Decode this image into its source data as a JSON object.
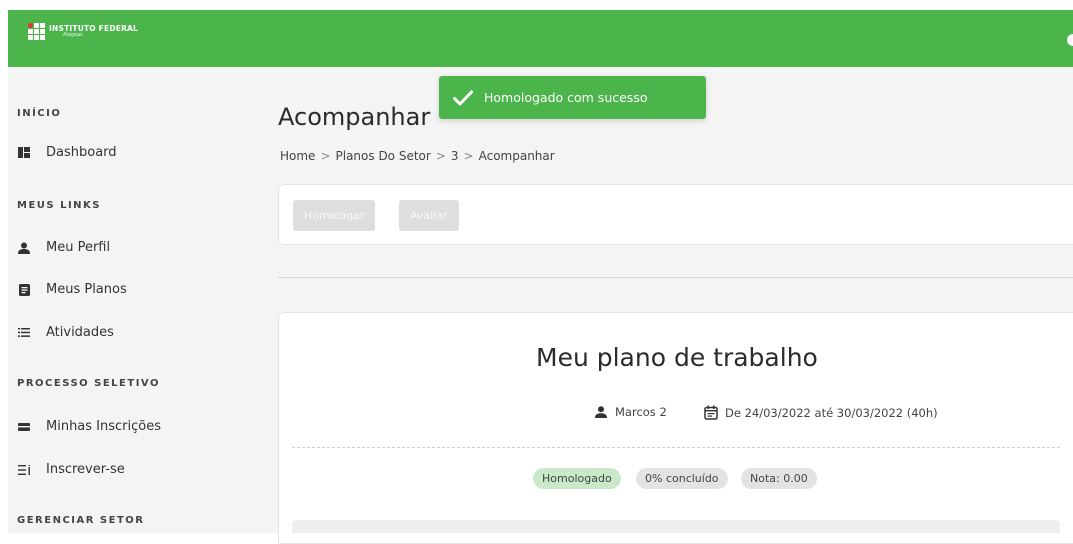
{
  "brand": {
    "name": "INSTITUTO FEDERAL",
    "campus": "Alagoas",
    "color": "#4bb54b"
  },
  "sidebar": {
    "sections": [
      {
        "title": "INÍCIO",
        "items": [
          {
            "label": "Dashboard",
            "icon": "dashboard-icon"
          }
        ]
      },
      {
        "title": "MEUS LINKS",
        "items": [
          {
            "label": "Meu Perfil",
            "icon": "person-icon"
          },
          {
            "label": "Meus Planos",
            "icon": "document-icon"
          },
          {
            "label": "Atividades",
            "icon": "list-icon"
          }
        ]
      },
      {
        "title": "PROCESSO SELETIVO",
        "items": [
          {
            "label": "Minhas Inscrições",
            "icon": "card-icon"
          },
          {
            "label": "Inscrever-se",
            "icon": "list-add-icon"
          }
        ]
      },
      {
        "title": "GERENCIAR SETOR",
        "items": []
      }
    ]
  },
  "page": {
    "title": "Acompanhar",
    "breadcrumb": [
      "Home",
      "Planos Do Setor",
      "3",
      "Acompanhar"
    ],
    "breadcrumb_separator": ">"
  },
  "actions": {
    "homologar": "Homologar",
    "avaliar": "Avaliar"
  },
  "plan": {
    "title": "Meu plano de trabalho",
    "author": "Marcos 2",
    "period": "De 24/03/2022 até 30/03/2022 (40h)",
    "status": "Homologado",
    "progress": "0% concluído",
    "grade": "Nota: 0.00"
  },
  "toast": {
    "message": "Homologado com sucesso"
  }
}
